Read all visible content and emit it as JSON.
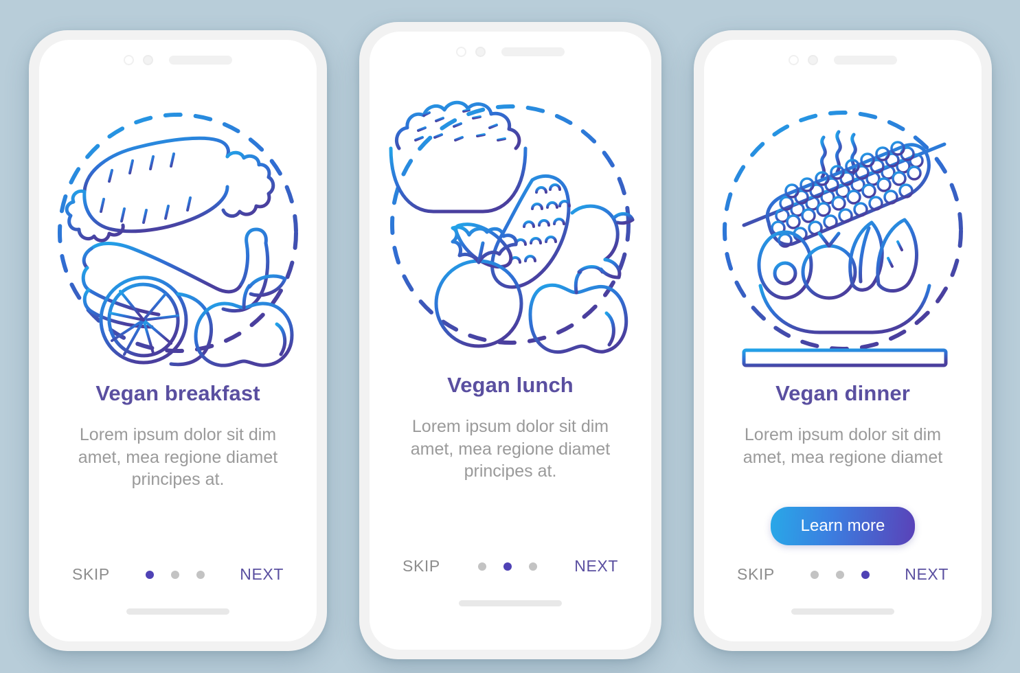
{
  "theme": {
    "background": "#b8cdd9",
    "screen_background": "#ffffff",
    "frame": "#f2f2f2",
    "title_color": "#5a4fa0",
    "body_color": "#9a9a9a",
    "accent_purple": "#4f42b5",
    "skip_color": "#8d8d8d",
    "next_color": "#5a4fa0",
    "dot_inactive": "#c3c3c3",
    "cta_gradient_from": "#29a8e8",
    "cta_gradient_to": "#5a42b8",
    "illustration_gradient_from": "#29a8e8",
    "illustration_gradient_to": "#4a3f9e"
  },
  "screens": [
    {
      "id": "vegan-breakfast",
      "illustration_name": "vegan-breakfast-illustration",
      "title": "Vegan breakfast",
      "description": "Lorem ipsum dolor sit dim amet, mea regione diamet principes at.",
      "skip_label": "SKIP",
      "next_label": "NEXT",
      "cta_label": null,
      "dots": [
        {
          "active": true
        },
        {
          "active": false
        },
        {
          "active": false
        }
      ]
    },
    {
      "id": "vegan-lunch",
      "illustration_name": "vegan-lunch-illustration",
      "title": "Vegan lunch",
      "description": "Lorem ipsum dolor sit dim amet, mea regione diamet principes at.",
      "skip_label": "SKIP",
      "next_label": "NEXT",
      "cta_label": null,
      "dots": [
        {
          "active": false
        },
        {
          "active": true
        },
        {
          "active": false
        }
      ]
    },
    {
      "id": "vegan-dinner",
      "illustration_name": "vegan-dinner-illustration",
      "title": "Vegan dinner",
      "description": "Lorem ipsum dolor sit dim amet, mea regione diamet",
      "skip_label": "SKIP",
      "next_label": "NEXT",
      "cta_label": "Learn more",
      "dots": [
        {
          "active": false
        },
        {
          "active": false
        },
        {
          "active": true
        }
      ]
    }
  ]
}
